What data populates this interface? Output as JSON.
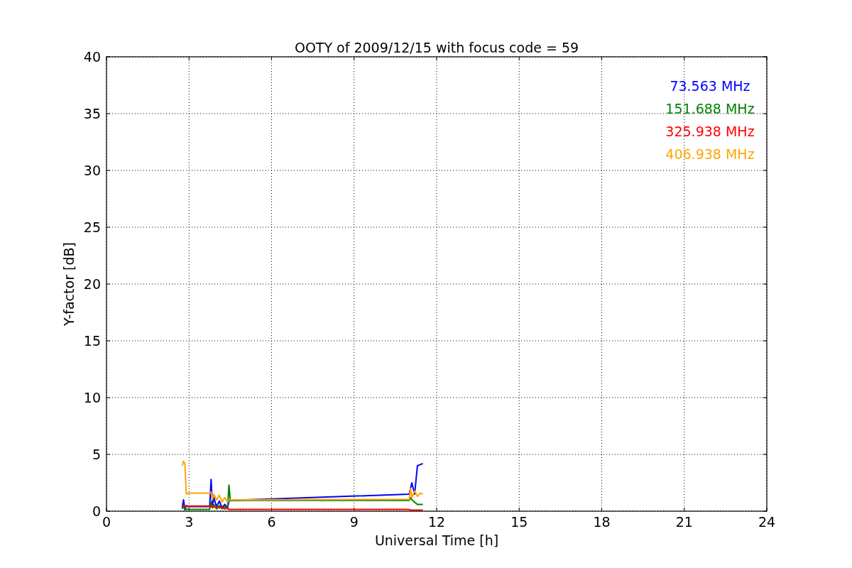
{
  "chart_data": {
    "type": "line",
    "title": "OOTY of 2009/12/15 with focus code = 59",
    "xlabel": "Universal Time [h]",
    "ylabel": "Y-factor [dB]",
    "grid": true,
    "x": [
      2.75,
      2.8,
      2.85,
      2.9,
      2.95,
      3.75,
      3.8,
      3.85,
      3.9,
      4.0,
      4.1,
      4.2,
      4.3,
      4.4,
      4.45,
      4.5,
      11.0,
      11.05,
      11.1,
      11.2,
      11.3,
      11.4,
      11.5
    ],
    "series": [
      {
        "name": "73.563 MHz",
        "color": "#0000ff",
        "values": [
          0.3,
          1.0,
          0.2,
          0.5,
          0.4,
          0.4,
          2.8,
          0.5,
          1.2,
          0.4,
          0.9,
          0.3,
          0.6,
          0.3,
          0.9,
          0.95,
          1.5,
          2.0,
          2.5,
          1.5,
          4.0,
          4.1,
          4.2
        ]
      },
      {
        "name": "151.688 MHz",
        "color": "#008000",
        "values": [
          0.2,
          0.5,
          0.1,
          0.2,
          0.15,
          0.15,
          0.8,
          0.3,
          0.6,
          0.2,
          0.5,
          0.2,
          0.4,
          0.2,
          2.3,
          0.95,
          0.95,
          1.2,
          1.0,
          0.8,
          0.6,
          0.6,
          0.6
        ]
      },
      {
        "name": "325.938 MHz",
        "color": "#ff0000",
        "values": [
          0.4,
          0.5,
          0.4,
          0.45,
          0.45,
          0.45,
          0.4,
          0.5,
          0.35,
          0.4,
          0.3,
          0.35,
          0.2,
          0.3,
          0.15,
          0.15,
          0.15,
          0.1,
          0.1,
          0.1,
          0.1,
          0.1,
          0.1
        ]
      },
      {
        "name": "406.938 MHz",
        "color": "#ffa500",
        "values": [
          4.0,
          4.4,
          4.2,
          1.5,
          1.6,
          1.6,
          1.7,
          1.0,
          1.5,
          1.0,
          1.4,
          0.8,
          1.2,
          0.8,
          1.0,
          1.0,
          1.05,
          2.0,
          1.2,
          1.8,
          1.3,
          1.6,
          1.5
        ]
      }
    ],
    "xlim": [
      0,
      24
    ],
    "ylim": [
      0,
      40
    ],
    "xticks": [
      0,
      3,
      6,
      9,
      12,
      15,
      18,
      21,
      24
    ],
    "yticks": [
      0,
      5,
      10,
      15,
      20,
      25,
      30,
      35,
      40
    ]
  }
}
